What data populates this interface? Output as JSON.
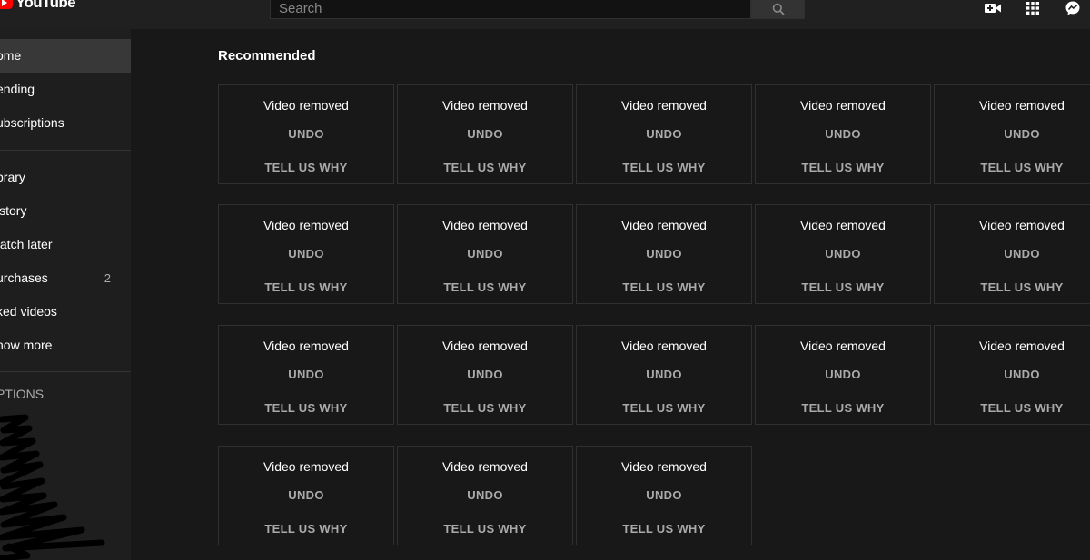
{
  "header": {
    "logo_text": "YouTube",
    "search_placeholder": "Search",
    "icons": [
      "create-video-icon",
      "apps-grid-icon",
      "messages-icon"
    ]
  },
  "sidebar": {
    "items": [
      {
        "label": "Home",
        "visible_label": "ome",
        "active": true
      },
      {
        "label": "Trending",
        "visible_label": "ending"
      },
      {
        "label": "Subscriptions",
        "visible_label": "ubscriptions"
      }
    ],
    "library_items": [
      {
        "label": "Library",
        "visible_label": "brary"
      },
      {
        "label": "History",
        "visible_label": "istory"
      },
      {
        "label": "Watch later",
        "visible_label": "/atch later"
      },
      {
        "label": "Purchases",
        "visible_label": "urchases",
        "count": "2"
      },
      {
        "label": "Liked videos",
        "visible_label": "ked videos"
      },
      {
        "label": "Show more",
        "visible_label": "how more"
      }
    ],
    "section_heading": "PTIONS"
  },
  "main": {
    "section_title": "Recommended",
    "cards": [
      {
        "title": "Video removed",
        "undo": "UNDO",
        "why": "TELL US WHY"
      },
      {
        "title": "Video removed",
        "undo": "UNDO",
        "why": "TELL US WHY"
      },
      {
        "title": "Video removed",
        "undo": "UNDO",
        "why": "TELL US WHY"
      },
      {
        "title": "Video removed",
        "undo": "UNDO",
        "why": "TELL US WHY"
      },
      {
        "title": "Video removed",
        "undo": "UNDO",
        "why": "TELL US WHY"
      },
      {
        "title": "Video removed",
        "undo": "UNDO",
        "why": "TELL US WHY"
      },
      {
        "title": "Video removed",
        "undo": "UNDO",
        "why": "TELL US WHY"
      },
      {
        "title": "Video removed",
        "undo": "UNDO",
        "why": "TELL US WHY"
      },
      {
        "title": "Video removed",
        "undo": "UNDO",
        "why": "TELL US WHY"
      },
      {
        "title": "Video removed",
        "undo": "UNDO",
        "why": "TELL US WHY"
      },
      {
        "title": "Video removed",
        "undo": "UNDO",
        "why": "TELL US WHY"
      },
      {
        "title": "Video removed",
        "undo": "UNDO",
        "why": "TELL US WHY"
      },
      {
        "title": "Video removed",
        "undo": "UNDO",
        "why": "TELL US WHY"
      },
      {
        "title": "Video removed",
        "undo": "UNDO",
        "why": "TELL US WHY"
      },
      {
        "title": "Video removed",
        "undo": "UNDO",
        "why": "TELL US WHY"
      },
      {
        "title": "Video removed",
        "undo": "UNDO",
        "why": "TELL US WHY"
      },
      {
        "title": "Video removed",
        "undo": "UNDO",
        "why": "TELL US WHY"
      },
      {
        "title": "Video removed",
        "undo": "UNDO",
        "why": "TELL US WHY"
      }
    ]
  },
  "colors": {
    "background": "#181818",
    "topbar": "#202020",
    "sidebar": "#1e1e1e",
    "active_item": "#383838",
    "brand_red": "#ff0000",
    "muted_text": "#aaaaaa"
  }
}
